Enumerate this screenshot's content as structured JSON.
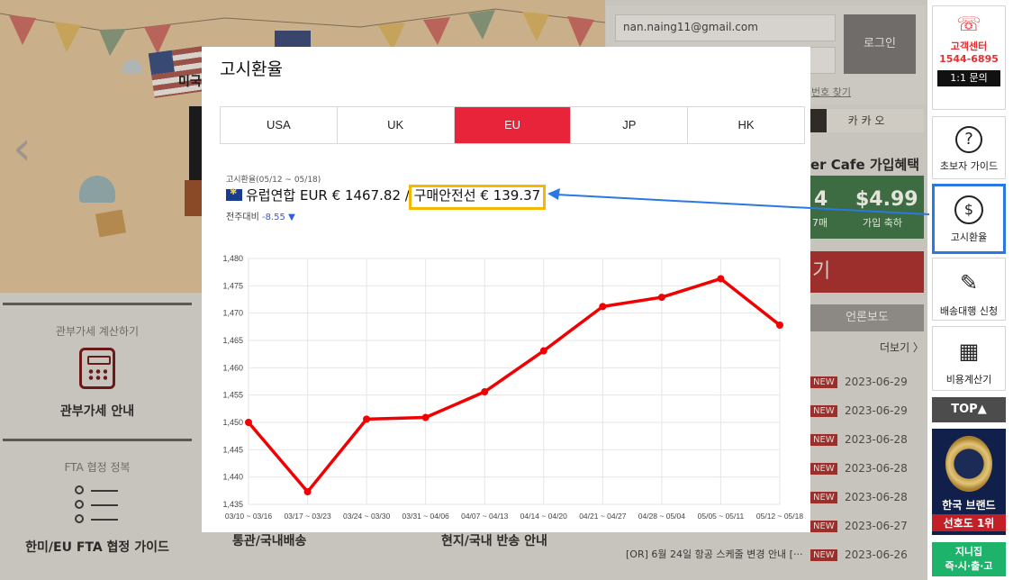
{
  "background": {
    "banner_prefix": "미국",
    "banner_prev": "‹",
    "tiles": [
      {
        "sub": "관부가세 계산하기",
        "title": "관부가세 안내"
      },
      {
        "sub": "FTA 협정 정복",
        "title": "한미/EU FTA 협정 가이드"
      }
    ],
    "bottom_labels": [
      "통관/국내배송",
      "현지/국내 반송 안내"
    ],
    "login": {
      "email": "nan.naing11@gmail.com",
      "button": "로그인",
      "find": "번호 찾기"
    },
    "kakao": "카 카 오",
    "cafe": "er Cafe 가입혜택",
    "promo": {
      "left_value": "4",
      "left_sub": "7매",
      "right_value": "$4.99",
      "right_sub": "가입 축하"
    },
    "redbar": "기",
    "news_tab": "언론보도",
    "more": "더보기 〉",
    "news": [
      {
        "tag": "NEW",
        "date": "2023-06-29"
      },
      {
        "tag": "NEW",
        "date": "2023-06-29"
      },
      {
        "tag": "NEW",
        "date": "2023-06-28"
      },
      {
        "tag": "NEW",
        "date": "2023-06-28"
      },
      {
        "tag": "NEW",
        "date": "2023-06-28"
      },
      {
        "tag": "NEW",
        "date": "2023-06-27"
      },
      {
        "tag": "NEW",
        "date": "2023-06-26"
      }
    ],
    "last_news_title": "[OR] 6월 24일 항공 스케줄 변경 안내 [···"
  },
  "sidebar": {
    "cs": {
      "l1": "고객센터",
      "l2": "1544-6895",
      "qa": "1:1 문의"
    },
    "items": [
      {
        "label": "초보자 가이드",
        "icon": "question-icon",
        "glyph": "?"
      },
      {
        "label": "고시환율",
        "icon": "exchange-icon",
        "glyph": "$"
      },
      {
        "label": "배송대행 신청",
        "icon": "pencil-icon",
        "glyph": "✎"
      },
      {
        "label": "비용계산기",
        "icon": "calculator-icon",
        "glyph": "▦"
      }
    ],
    "top": "TOP▲",
    "brand": {
      "l1": "한국 브랜드",
      "l2": "선호도 1위"
    },
    "quick": {
      "l1": "지니집",
      "l2": "즉·시·출·고"
    }
  },
  "modal": {
    "title": "고시환율",
    "tabs": [
      "USA",
      "UK",
      "EU",
      "JP",
      "HK"
    ],
    "active_tab": "EU",
    "period": "고시환율(05/12 ~ 05/18)",
    "currency": "유럽연합 EUR",
    "rate": "€ 1467.82",
    "sep": "/",
    "safety_label": "구매안전선",
    "safety_rate": "€ 139.37",
    "week_label": "전주대비",
    "week_value": "-8.55",
    "week_arrow": "▼"
  },
  "colors": {
    "accent_red": "#e8243b",
    "chart_line": "#f00000",
    "highlight": "#f2b900",
    "annotation": "#2b78e4"
  },
  "chart_data": {
    "type": "line",
    "categories": [
      "03/10 ~ 03/16",
      "03/17 ~ 03/23",
      "03/24 ~ 03/30",
      "03/31 ~ 04/06",
      "04/07 ~ 04/13",
      "04/14 ~ 04/20",
      "04/21 ~ 04/27",
      "04/28 ~ 05/04",
      "05/05 ~ 05/11",
      "05/12 ~ 05/18"
    ],
    "series": [
      {
        "values": [
          1450.0,
          1437.3,
          1450.6,
          1450.9,
          1455.6,
          1463.1,
          1471.2,
          1472.9,
          1476.3,
          1467.8
        ]
      }
    ],
    "ylim": [
      1435,
      1480
    ],
    "yticks": [
      "1,435",
      "1,440",
      "1,445",
      "1,450",
      "1,455",
      "1,460",
      "1,465",
      "1,470",
      "1,475",
      "1,480"
    ],
    "grid": true
  }
}
